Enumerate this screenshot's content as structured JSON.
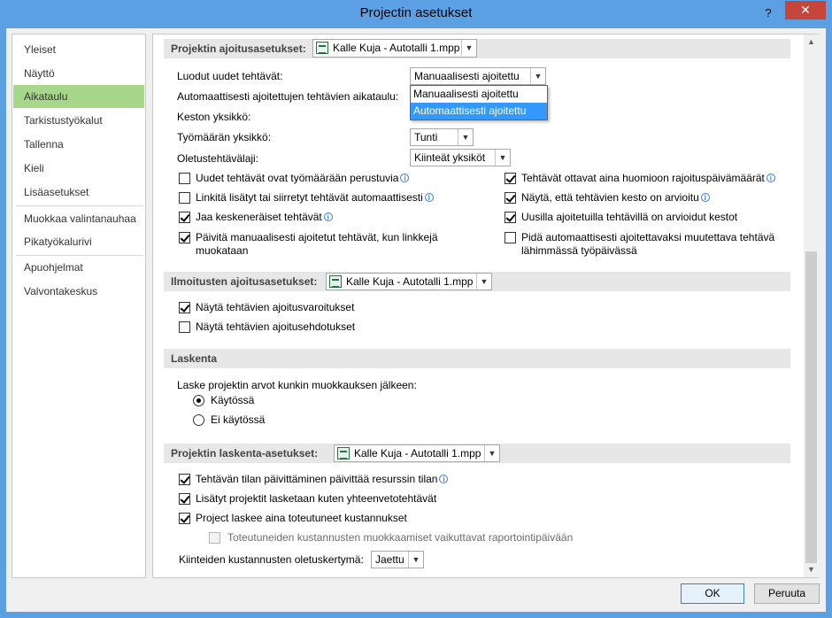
{
  "window": {
    "title": "Projectin asetukset",
    "help": "?",
    "close": "✕"
  },
  "nav": {
    "items": [
      "Yleiset",
      "Näyttö",
      "Aikataulu",
      "Tarkistustyökalut",
      "Tallenna",
      "Kieli",
      "Lisäasetukset",
      "Muokkaa valintanauhaa",
      "Pikatyökalurivi",
      "Apuohjelmat",
      "Valvontakeskus"
    ],
    "selected": "Aikataulu"
  },
  "file_name": "Kalle Kuja - Autotalli 1.mpp",
  "scheduling": {
    "header": "Projektin ajoitusasetukset:",
    "new_tasks_label": "Luodut uudet tehtävät:",
    "new_tasks_value": "Manuaalisesti ajoitettu",
    "auto_tasks_label": "Automaattisesti ajoitettujen tehtävien aikataulu:",
    "duration_label": "Keston yksikkö:",
    "work_label": "Työmäärän yksikkö:",
    "work_value": "Tunti",
    "task_type_label": "Oletustehtävälaji:",
    "task_type_value": "Kiinteät yksiköt",
    "dropdown_options": [
      "Manuaalisesti ajoitettu",
      "Automaattisesti ajoitettu"
    ],
    "checks_left": [
      {
        "label": "Uudet tehtävät ovat työmäärään perustuvia",
        "checked": false,
        "info": true
      },
      {
        "label": "Linkitä lisätyt tai siirretyt tehtävät automaattisesti",
        "checked": false,
        "info": true
      },
      {
        "label": "Jaa keskeneräiset tehtävät",
        "checked": true,
        "info": true
      },
      {
        "label": "Päivitä manuaalisesti ajoitetut tehtävät, kun linkkejä",
        "label2": "muokataan",
        "checked": true,
        "info": false
      }
    ],
    "checks_right": [
      {
        "label": "Tehtävät ottavat aina huomioon rajoituspäivämäärät",
        "checked": true,
        "info": true
      },
      {
        "label": "Näytä, että tehtävien kesto on arvioitu",
        "checked": true,
        "info": true
      },
      {
        "label": "Uusilla ajoitetuilla tehtävillä on arvioidut kestot",
        "checked": true,
        "info": false
      },
      {
        "label": "Pidä automaattisesti ajoitettavaksi muutettava tehtävä",
        "label2": "lähimmässä työpäivässä",
        "checked": false,
        "info": false
      }
    ]
  },
  "alerts": {
    "header": "Ilmoitusten ajoitusasetukset:",
    "checks": [
      {
        "label": "Näytä tehtävien ajoitusvaroitukset",
        "checked": true
      },
      {
        "label": "Näytä tehtävien ajoitusehdotukset",
        "checked": false
      }
    ]
  },
  "calculation": {
    "header": "Laskenta",
    "question": "Laske projektin arvot kunkin muokkauksen jälkeen:",
    "options": [
      {
        "label": "Käytössä",
        "selected": true
      },
      {
        "label": "Ei käytössä",
        "selected": false
      }
    ]
  },
  "calc_options": {
    "header": "Projektin laskenta-asetukset:",
    "checks": [
      {
        "label": "Tehtävän tilan päivittäminen päivittää resurssin tilan",
        "checked": true,
        "info": true
      },
      {
        "label": "Lisätyt projektit lasketaan kuten yhteenvetotehtävät",
        "checked": true,
        "info": false
      },
      {
        "label": "Project laskee aina toteutuneet kustannukset",
        "checked": true,
        "info": false
      },
      {
        "label": "Toteutuneiden kustannusten muokkaamiset vaikuttavat raportointipäivään",
        "checked": false,
        "info": false,
        "disabled": true
      }
    ],
    "accrual_label": "Kiinteiden kustannusten oletuskertymä:",
    "accrual_value": "Jaettu"
  },
  "buttons": {
    "ok": "OK",
    "cancel": "Peruuta"
  },
  "colors": {
    "titlebar": "#5ba0e3",
    "nav_selected": "#a6d78b",
    "dropdown_highlight": "#3399ff",
    "close": "#c7463b"
  },
  "icons": {
    "file": "project-file-icon",
    "info": "info-icon",
    "dropdown": "chevron-down-icon"
  }
}
